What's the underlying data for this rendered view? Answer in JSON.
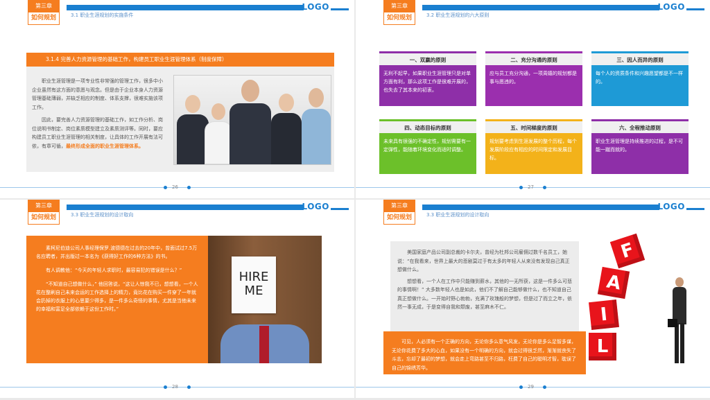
{
  "header": {
    "chapter_tab": "第三章",
    "chapter_title": "如何规划",
    "logo": "LOGO"
  },
  "slides": [
    {
      "subsection": "3.1 职业生涯规划的实施条件",
      "banner": "3.1.4 完善人力资源管理的基础工作，构建员工职业生涯管理体系（制度保障）",
      "paragraph1": "职业生涯管理是一项专业性非常强的管理工作，很多中小企业虽然有这方面的意愿与观念。但是由于企业本身人力资源管理基础薄弱，并缺乏相应的制度、体系支撑，很难实施该项工作。",
      "paragraph2_plain": "因此，要完善人力资源管理的基础工作，如工作分析、岗位说明书制定、岗位素质模型建立及素质测评等。同时，要应构建员工职业生涯管理的相关制度，让具体的工作开展有法可依，有章可循，",
      "paragraph2_highlight": "最终形成全面的职业生涯管理体系。",
      "page": "26"
    },
    {
      "subsection": "3.2 职业生涯规划的六大原则",
      "cards": [
        {
          "title": "一、双赢的原则",
          "body": "无利不起早，如果职业生涯管理只是对单方面有利，那么这项工作是很难开展的，也失去了其本来的初衷。"
        },
        {
          "title": "二、充分沟通的原则",
          "body": "应与员工充分沟通，一项周嬉的规划都是事与愿违的。"
        },
        {
          "title": "三、因人而异的原则",
          "body": "每个人的资质条件和兴趣愿望都是不一样的。"
        },
        {
          "title": "四、动态目标的原则",
          "body": "未来具有很强的不确定性，规划需要有一定弹性，能随着环境变化而适时调整。"
        },
        {
          "title": "五、时间梯度的原则",
          "body": "规划要考虑到生涯发展的整个历程，每个发展阶段应有相应的时间限定和发展目标。"
        },
        {
          "title": "六、全程推动原则",
          "body": "职业生涯管理是持续推进的过程，是不可能一蹴而就的。"
        }
      ],
      "colors": [
        "#8e2fa8",
        "#8e2fa8",
        "#1e9ad6",
        "#6cc02a",
        "#f3b21a",
        "#8e2fa8"
      ],
      "page": "27"
    },
    {
      "subsection": "3.3 职业生涯规划的设计取向",
      "paragraph1": "素柯尼伯迪公司人事经理保罗.波德德在过去的20年中，曾面试过7.5万名应聘者，并出版过一本名为《获得好工作的6种方法》的书。",
      "paragraph2": "有人调教他：“今天的年轻人求职时，最容易犯的错误是什么？”",
      "paragraph3": "“不知道自己想做什么，” 他回答说，“这让人惊我不已，想想看，一个人花在整刷自己未来会运的工作选择上的精力，竟比花在购买一件穿了一年就会扔掉的衣服上的心思要少得多，是一件多么奇怪的事情，尤其是当他未来的幸福和富足全部依赖于这份工作时。”",
      "hire_line1": "HIRE",
      "hire_line2": "ME",
      "page": "28"
    },
    {
      "subsection": "3.3 职业生涯规划的设计取向",
      "paragraph1": "美国家庭产品公司副总裁的卡尔夫，曾经为杜邦公司雇佣过数千名员工，她说：“在我看来，世界上最大的悲剧莫过于有太多的年轻人从来没有发现自己真正想做什么。",
      "paragraph2": "想想看，一个人在工作中只能赚到薪水，其他的一无所获，这是一件多么可悲的事情啊！” 大多数年轻人也是如此，他们不了解自己能够做什么，也不知道自己真正想做什么。一开始时野心勃勃，充满了玫瑰般的梦想，但是过了而立之年，依然一事无成，于是变得自我和颓废，甚至麻木不仁。",
      "paragraph3": "可见，人必须有一个正确的方向，无论你多么意气风发，无论你是多么足智多谋，无论你花费了多大的心血，如果没有一个明确的方向，就会过得很乏然，渐渐就丧失了斗志，忘却了最初的梦想，就会走上弯路甚至不归路，枉费了自己的聪明才智，耽误了自己的锦绣芳华。",
      "cubes": [
        "F",
        "A",
        "I",
        "L"
      ],
      "page": "29"
    }
  ],
  "accent_colors": {
    "orange": "#f57d1f",
    "blue": "#1a7fd0",
    "red": "#e8141b"
  }
}
